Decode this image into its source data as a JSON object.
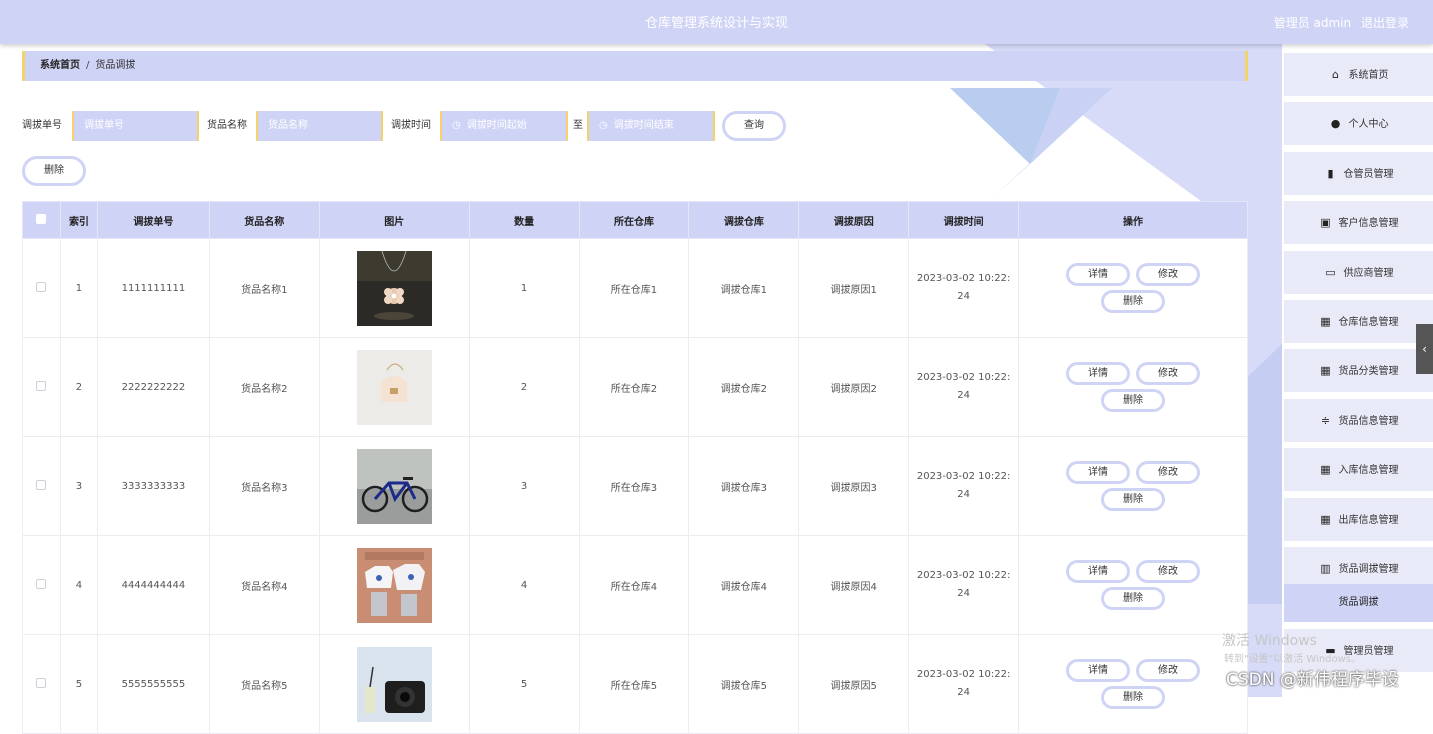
{
  "header": {
    "title": "仓库管理系统设计与实现",
    "user_prefix": "管理员 admin",
    "logout": "退出登录"
  },
  "breadcrumb": {
    "home": "系统首页",
    "separator": "/",
    "current": "货品调拔"
  },
  "search": {
    "label_no": "调拔单号",
    "placeholder_no": "调拔单号",
    "label_name": "货品名称",
    "placeholder_name": "货品名称",
    "label_time": "调拔时间",
    "placeholder_start": "调拔时间起始",
    "to": "至",
    "placeholder_end": "调拔时间结束",
    "query_button": "查询",
    "delete_button": "删除"
  },
  "table": {
    "columns": [
      "索引",
      "调拔单号",
      "货品名称",
      "图片",
      "数量",
      "所在仓库",
      "调拔仓库",
      "调拔原因",
      "调拔时间",
      "操作"
    ],
    "rows": [
      {
        "index": "1",
        "no": "1111111111",
        "name": "货品名称1",
        "qty": "1",
        "warehouse": "所在仓库1",
        "target": "调拔仓库1",
        "reason": "调拔原因1",
        "time1": "2023-03-02 10:22:",
        "time2": "24"
      },
      {
        "index": "2",
        "no": "2222222222",
        "name": "货品名称2",
        "qty": "2",
        "warehouse": "所在仓库2",
        "target": "调拔仓库2",
        "reason": "调拔原因2",
        "time1": "2023-03-02 10:22:",
        "time2": "24"
      },
      {
        "index": "3",
        "no": "3333333333",
        "name": "货品名称3",
        "qty": "3",
        "warehouse": "所在仓库3",
        "target": "调拔仓库3",
        "reason": "调拔原因3",
        "time1": "2023-03-02 10:22:",
        "time2": "24"
      },
      {
        "index": "4",
        "no": "4444444444",
        "name": "货品名称4",
        "qty": "4",
        "warehouse": "所在仓库4",
        "target": "调拔仓库4",
        "reason": "调拔原因4",
        "time1": "2023-03-02 10:22:",
        "time2": "24"
      },
      {
        "index": "5",
        "no": "5555555555",
        "name": "货品名称5",
        "qty": "5",
        "warehouse": "所在仓库5",
        "target": "调拔仓库5",
        "reason": "调拔原因5",
        "time1": "2023-03-02 10:22:",
        "time2": "24"
      }
    ],
    "actions": {
      "detail": "详情",
      "edit": "修改",
      "delete": "删除"
    }
  },
  "sidebar": {
    "items": [
      {
        "label": "系统首页",
        "icon": "home-icon"
      },
      {
        "label": "个人中心",
        "icon": "user-icon"
      },
      {
        "label": "仓管员管理",
        "icon": "bar-chart-icon"
      },
      {
        "label": "客户信息管理",
        "icon": "clipboard-icon"
      },
      {
        "label": "供应商管理",
        "icon": "monitor-icon"
      },
      {
        "label": "仓库信息管理",
        "icon": "grid-icon"
      },
      {
        "label": "货品分类管理",
        "icon": "grid-icon"
      },
      {
        "label": "货品信息管理",
        "icon": "sliders-icon"
      },
      {
        "label": "入库信息管理",
        "icon": "grid-icon"
      },
      {
        "label": "出库信息管理",
        "icon": "grid-icon"
      },
      {
        "label": "货品调拔管理",
        "icon": "library-icon"
      }
    ],
    "sub_item": "货品调拔",
    "last_item": {
      "label": "管理员管理",
      "icon": "briefcase-icon"
    }
  },
  "overlay": {
    "activate_title": "激活 Windows",
    "activate_sub": "转到\"设置\"以激活 Windows。",
    "csdn": "CSDN @新伟程序毕设"
  },
  "colors": {
    "accent": "#cfd3f5",
    "border_accent": "#f5d36b"
  }
}
